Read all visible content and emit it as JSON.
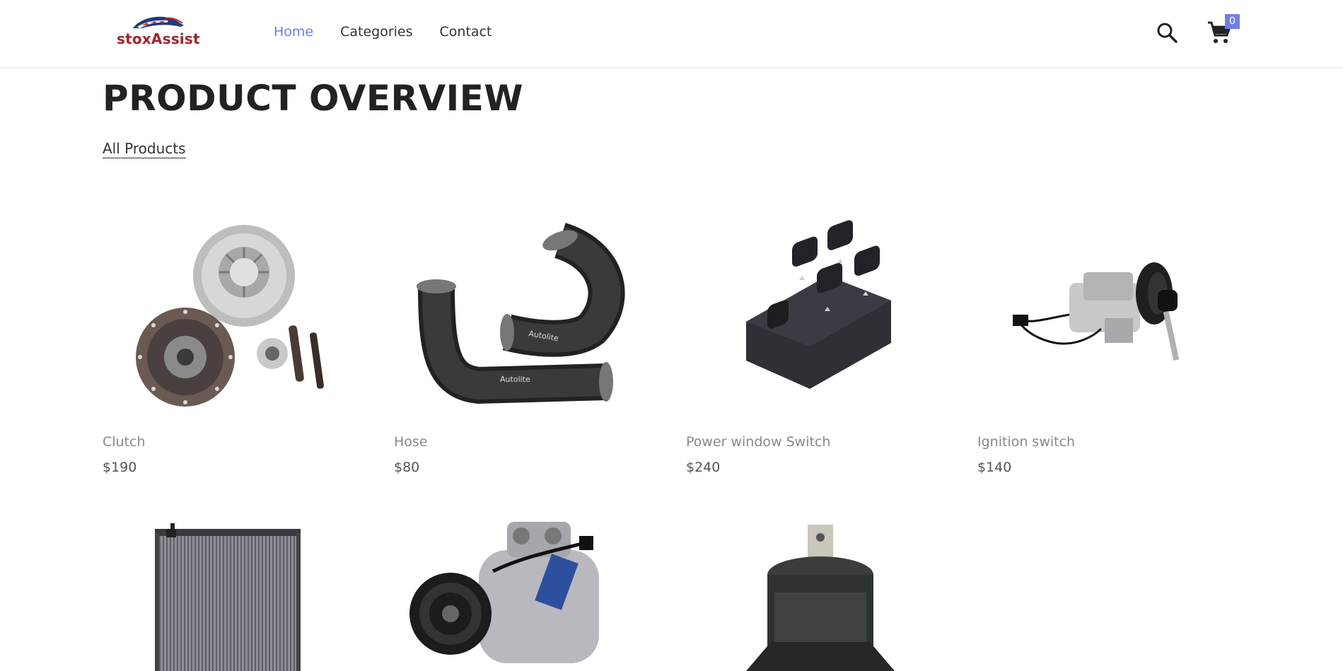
{
  "header": {
    "logo_text": "stoxAssist",
    "nav": [
      {
        "label": "Home",
        "active": true
      },
      {
        "label": "Categories",
        "active": false
      },
      {
        "label": "Contact",
        "active": false
      }
    ],
    "search_icon": "search-icon",
    "cart_icon": "cart-icon",
    "cart_count": "0"
  },
  "main": {
    "title": "PRODUCT OVERVIEW",
    "filter_label": "All Products",
    "products": [
      {
        "name": "Clutch",
        "price": "$190",
        "icon": "clutch-kit-image"
      },
      {
        "name": "Hose",
        "price": "$80",
        "icon": "hose-image"
      },
      {
        "name": "Power window Switch",
        "price": "$240",
        "icon": "power-window-switch-image"
      },
      {
        "name": "Ignition switch",
        "price": "$140",
        "icon": "ignition-switch-image"
      },
      {
        "name": "",
        "price": "",
        "icon": "radiator-image"
      },
      {
        "name": "",
        "price": "",
        "icon": "ac-compressor-image"
      },
      {
        "name": "",
        "price": "",
        "icon": "engine-mount-image"
      }
    ]
  },
  "colors": {
    "accent": "#717fe0",
    "logo_red": "#a5232b",
    "title": "#222222",
    "product_name": "#888888"
  }
}
